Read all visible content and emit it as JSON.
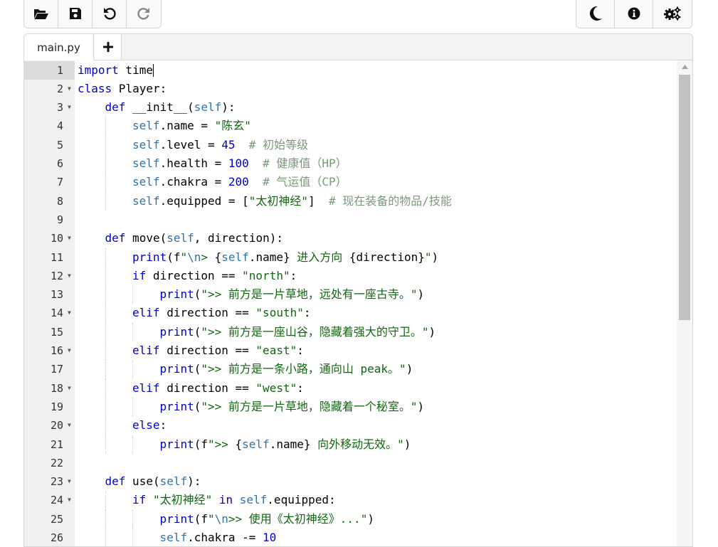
{
  "toolbar": {
    "left": [
      {
        "name": "open-folder-icon"
      },
      {
        "name": "save-icon"
      },
      {
        "name": "undo-icon"
      },
      {
        "name": "redo-icon"
      }
    ],
    "right": [
      {
        "name": "dark-mode-moon-icon"
      },
      {
        "name": "info-icon"
      },
      {
        "name": "settings-gears-icon"
      }
    ]
  },
  "tabs": [
    {
      "label": "main.py",
      "active": true
    }
  ],
  "add_tab_label": "+",
  "editor": {
    "active_line": 1,
    "fold_lines": [
      2,
      3,
      10,
      12,
      14,
      16,
      18,
      20,
      23,
      24
    ],
    "lines": [
      {
        "n": "1",
        "indent": 0,
        "tokens": [
          [
            "kw",
            "import"
          ],
          [
            "txt",
            " time"
          ]
        ]
      },
      {
        "n": "2",
        "indent": 0,
        "tokens": [
          [
            "kw",
            "class"
          ],
          [
            "txt",
            " Player:"
          ]
        ]
      },
      {
        "n": "3",
        "indent": 1,
        "tokens": [
          [
            "kw",
            "def"
          ],
          [
            "txt",
            " __init__("
          ],
          [
            "self",
            "self"
          ],
          [
            "txt",
            "):"
          ]
        ]
      },
      {
        "n": "4",
        "indent": 2,
        "tokens": [
          [
            "self",
            "self"
          ],
          [
            "txt",
            ".name = "
          ],
          [
            "str",
            "\"陈玄\""
          ]
        ]
      },
      {
        "n": "5",
        "indent": 2,
        "tokens": [
          [
            "self",
            "self"
          ],
          [
            "txt",
            ".level = "
          ],
          [
            "num",
            "45"
          ],
          [
            "txt",
            "  "
          ],
          [
            "cm",
            "# 初始等级"
          ]
        ]
      },
      {
        "n": "6",
        "indent": 2,
        "tokens": [
          [
            "self",
            "self"
          ],
          [
            "txt",
            ".health = "
          ],
          [
            "num",
            "100"
          ],
          [
            "txt",
            "  "
          ],
          [
            "cm",
            "# 健康值（HP）"
          ]
        ]
      },
      {
        "n": "7",
        "indent": 2,
        "tokens": [
          [
            "self",
            "self"
          ],
          [
            "txt",
            ".chakra = "
          ],
          [
            "num",
            "200"
          ],
          [
            "txt",
            "  "
          ],
          [
            "cm",
            "# 气运值（CP）"
          ]
        ]
      },
      {
        "n": "8",
        "indent": 2,
        "tokens": [
          [
            "self",
            "self"
          ],
          [
            "txt",
            ".equipped = ["
          ],
          [
            "str",
            "\"太初神经\""
          ],
          [
            "txt",
            "]  "
          ],
          [
            "cm",
            "# 现在装备的物品/技能"
          ]
        ]
      },
      {
        "n": "9",
        "indent": 0,
        "tokens": []
      },
      {
        "n": "10",
        "indent": 1,
        "tokens": [
          [
            "kw",
            "def"
          ],
          [
            "txt",
            " move("
          ],
          [
            "self",
            "self"
          ],
          [
            "txt",
            ", direction):"
          ]
        ]
      },
      {
        "n": "11",
        "indent": 2,
        "tokens": [
          [
            "fn",
            "print"
          ],
          [
            "txt",
            "(f"
          ],
          [
            "str",
            "\""
          ],
          [
            "esc",
            "\\n"
          ],
          [
            "str",
            "> "
          ],
          [
            "txt",
            "{"
          ],
          [
            "self",
            "self"
          ],
          [
            "txt",
            ".name}"
          ],
          [
            "str",
            " 进入方向 "
          ],
          [
            "txt",
            "{direction}"
          ],
          [
            "str",
            "\""
          ],
          [
            "txt",
            ")"
          ]
        ]
      },
      {
        "n": "12",
        "indent": 2,
        "tokens": [
          [
            "kw",
            "if"
          ],
          [
            "txt",
            " direction == "
          ],
          [
            "str",
            "\"north\""
          ],
          [
            "txt",
            ":"
          ]
        ]
      },
      {
        "n": "13",
        "indent": 3,
        "tokens": [
          [
            "fn",
            "print"
          ],
          [
            "txt",
            "("
          ],
          [
            "str",
            "\">> 前方是一片草地，远处有一座古寺。\""
          ],
          [
            "txt",
            ")"
          ]
        ]
      },
      {
        "n": "14",
        "indent": 2,
        "tokens": [
          [
            "kw",
            "elif"
          ],
          [
            "txt",
            " direction == "
          ],
          [
            "str",
            "\"south\""
          ],
          [
            "txt",
            ":"
          ]
        ]
      },
      {
        "n": "15",
        "indent": 3,
        "tokens": [
          [
            "fn",
            "print"
          ],
          [
            "txt",
            "("
          ],
          [
            "str",
            "\">> 前方是一座山谷，隐藏着强大的守卫。\""
          ],
          [
            "txt",
            ")"
          ]
        ]
      },
      {
        "n": "16",
        "indent": 2,
        "tokens": [
          [
            "kw",
            "elif"
          ],
          [
            "txt",
            " direction == "
          ],
          [
            "str",
            "\"east\""
          ],
          [
            "txt",
            ":"
          ]
        ]
      },
      {
        "n": "17",
        "indent": 3,
        "tokens": [
          [
            "fn",
            "print"
          ],
          [
            "txt",
            "("
          ],
          [
            "str",
            "\">> 前方是一条小路，通向山 peak。\""
          ],
          [
            "txt",
            ")"
          ]
        ]
      },
      {
        "n": "18",
        "indent": 2,
        "tokens": [
          [
            "kw",
            "elif"
          ],
          [
            "txt",
            " direction == "
          ],
          [
            "str",
            "\"west\""
          ],
          [
            "txt",
            ":"
          ]
        ]
      },
      {
        "n": "19",
        "indent": 3,
        "tokens": [
          [
            "fn",
            "print"
          ],
          [
            "txt",
            "("
          ],
          [
            "str",
            "\">> 前方是一片草地，隐藏着一个秘室。\""
          ],
          [
            "txt",
            ")"
          ]
        ]
      },
      {
        "n": "20",
        "indent": 2,
        "tokens": [
          [
            "kw",
            "else"
          ],
          [
            "txt",
            ":"
          ]
        ]
      },
      {
        "n": "21",
        "indent": 3,
        "tokens": [
          [
            "fn",
            "print"
          ],
          [
            "txt",
            "(f"
          ],
          [
            "str",
            "\">> "
          ],
          [
            "txt",
            "{"
          ],
          [
            "self",
            "self"
          ],
          [
            "txt",
            ".name}"
          ],
          [
            "str",
            " 向外移动无效。\""
          ],
          [
            "txt",
            ")"
          ]
        ]
      },
      {
        "n": "22",
        "indent": 0,
        "tokens": []
      },
      {
        "n": "23",
        "indent": 1,
        "tokens": [
          [
            "kw",
            "def"
          ],
          [
            "txt",
            " use("
          ],
          [
            "self",
            "self"
          ],
          [
            "txt",
            "):"
          ]
        ]
      },
      {
        "n": "24",
        "indent": 2,
        "tokens": [
          [
            "kw",
            "if"
          ],
          [
            "txt",
            " "
          ],
          [
            "str",
            "\"太初神经\""
          ],
          [
            "txt",
            " "
          ],
          [
            "kw",
            "in"
          ],
          [
            "txt",
            " "
          ],
          [
            "self",
            "self"
          ],
          [
            "txt",
            ".equipped:"
          ]
        ]
      },
      {
        "n": "25",
        "indent": 3,
        "tokens": [
          [
            "fn",
            "print"
          ],
          [
            "txt",
            "(f"
          ],
          [
            "str",
            "\""
          ],
          [
            "esc",
            "\\n"
          ],
          [
            "str",
            ">> 使用《太初神经》...\""
          ],
          [
            "txt",
            ")"
          ]
        ]
      },
      {
        "n": "26",
        "indent": 3,
        "tokens": [
          [
            "self",
            "self"
          ],
          [
            "txt",
            ".chakra -= "
          ],
          [
            "num",
            "10"
          ]
        ]
      }
    ]
  }
}
